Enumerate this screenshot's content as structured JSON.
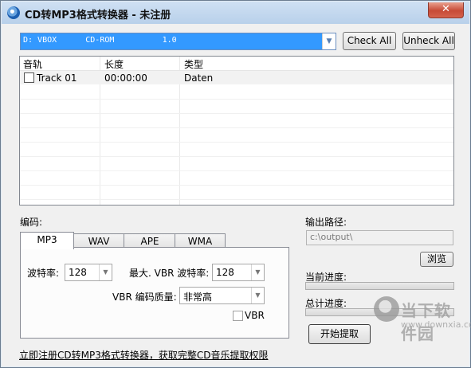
{
  "window": {
    "title": "CD转MP3格式转换器 - 未注册",
    "close_glyph": "✕"
  },
  "drive": {
    "selected": "D: VBOX      CD-ROM          1.0",
    "dropdown_glyph": "▼"
  },
  "buttons": {
    "check_all": "Check All",
    "uncheck_all": "Unheck All",
    "browse": "浏览",
    "start_extract": "开始提取"
  },
  "track_list": {
    "columns": [
      "音轨",
      "长度",
      "类型"
    ],
    "rows": [
      {
        "checked": false,
        "track": "Track 01",
        "length": "00:00:00",
        "type": "Daten"
      }
    ]
  },
  "encoding": {
    "label": "编码:",
    "tabs": [
      "MP3",
      "WAV",
      "APE",
      "WMA"
    ],
    "active_tab": "MP3",
    "bitrate_label": "波特率:",
    "bitrate_value": "128",
    "max_vbr_label": "最大. VBR 波特率:",
    "max_vbr_value": "128",
    "vbr_quality_label": "VBR 编码质量:",
    "vbr_quality_value": "非常高",
    "vbr_checkbox_label": "VBR",
    "vbr_checked": false,
    "combo_glyph": "▼"
  },
  "output": {
    "label": "输出路径:",
    "path": "c:\\output\\"
  },
  "progress": {
    "current_label": "当前进度:",
    "current_value": 0,
    "total_label": "总计进度:",
    "total_value": 0
  },
  "register_link": "立即注册CD转MP3格式转换器，获取完整CD音乐提取权限",
  "watermark": {
    "name": "当下软件园",
    "url": "www.downxia.com"
  }
}
